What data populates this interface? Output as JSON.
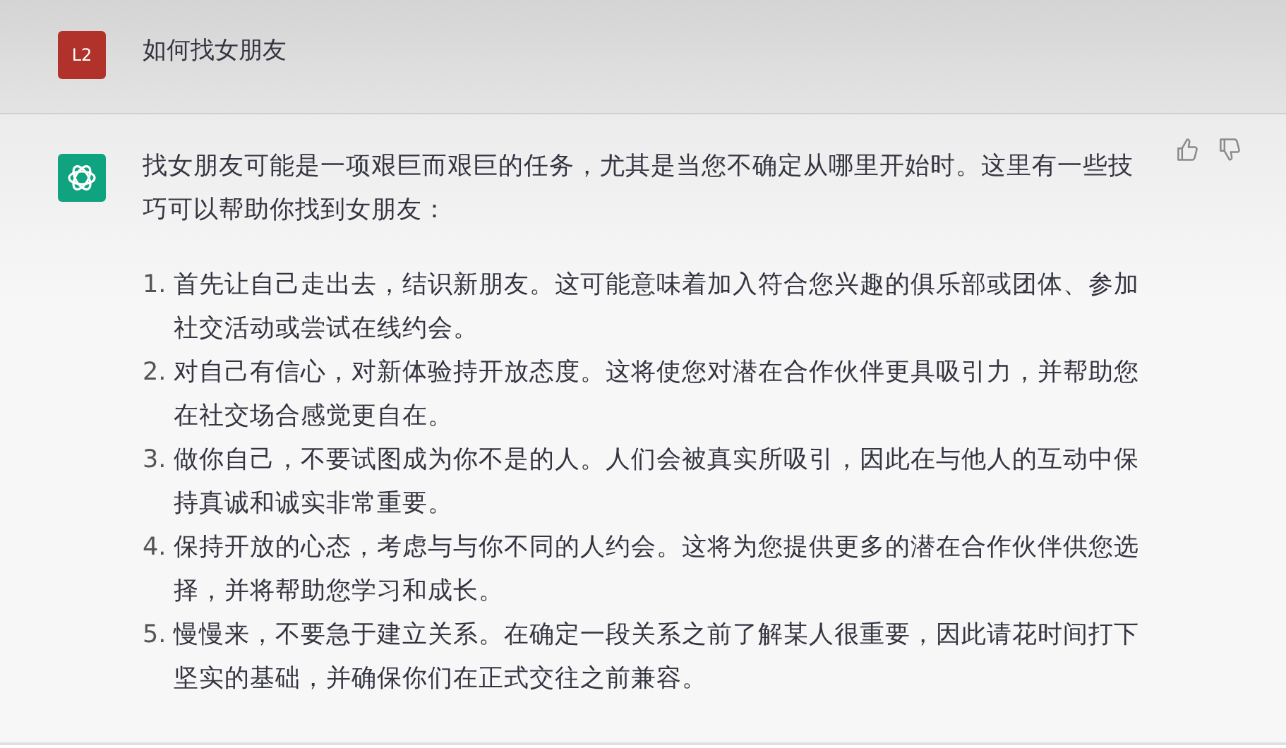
{
  "user_message": {
    "avatar": "L2",
    "text": "如何找女朋友"
  },
  "assistant_message": {
    "intro": "找女朋友可能是一项艰巨而艰巨的任务，尤其是当您不确定从哪里开始时。这里有一些技巧可以帮助你找到女朋友：",
    "tips": [
      {
        "number": "1.",
        "text": "首先让自己走出去，结识新朋友。这可能意味着加入符合您兴趣的俱乐部或团体、参加社交活动或尝试在线约会。"
      },
      {
        "number": "2.",
        "text": "对自己有信心，对新体验持开放态度。这将使您对潜在合作伙伴更具吸引力，并帮助您在社交场合感觉更自在。"
      },
      {
        "number": "3.",
        "text": "做你自己，不要试图成为你不是的人。人们会被真实所吸引，因此在与他人的互动中保持真诚和诚实非常重要。"
      },
      {
        "number": "4.",
        "text": "保持开放的心态，考虑与与你不同的人约会。这将为您提供更多的潜在合作伙伴供您选择，并将帮助您学习和成长。"
      },
      {
        "number": "5.",
        "text": "慢慢来，不要急于建立关系。在确定一段关系之前了解某人很重要，因此请花时间打下坚实的基础，并确保你们在正式交往之前兼容。"
      }
    ]
  }
}
